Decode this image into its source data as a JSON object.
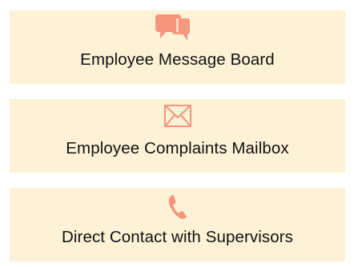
{
  "theme": {
    "card_background": "#fdf2d6",
    "icon_color": "#f4957c",
    "text_color": "#111111"
  },
  "cards": [
    {
      "label": "Employee Message Board",
      "icon": "chat-bubbles-icon"
    },
    {
      "label": "Employee Complaints Mailbox",
      "icon": "envelope-icon"
    },
    {
      "label": "Direct Contact with Supervisors",
      "icon": "phone-icon"
    }
  ]
}
